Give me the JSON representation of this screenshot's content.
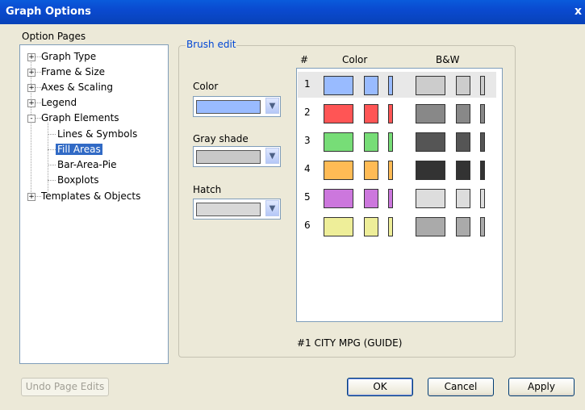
{
  "window": {
    "title": "Graph Options",
    "close": "x"
  },
  "option_pages": {
    "label": "Option Pages",
    "items": [
      {
        "label": "Graph Type",
        "expander": "+"
      },
      {
        "label": "Frame & Size",
        "expander": "+"
      },
      {
        "label": "Axes & Scaling",
        "expander": "+"
      },
      {
        "label": "Legend",
        "expander": "+"
      },
      {
        "label": "Graph Elements",
        "expander": "-"
      },
      {
        "label": "Lines & Symbols"
      },
      {
        "label": "Fill Areas",
        "selected": true
      },
      {
        "label": "Bar-Area-Pie"
      },
      {
        "label": "Boxplots"
      },
      {
        "label": "Templates & Objects",
        "expander": "+"
      }
    ]
  },
  "brush_edit": {
    "title": "Brush edit",
    "color_label": "Color",
    "color_value": "#99bbff",
    "gray_label": "Gray shade",
    "gray_value": "#c8c8c8",
    "hatch_label": "Hatch",
    "hatch_value": "#d8d8d8",
    "dropdown_icon": "chevron-down-icon"
  },
  "brush_table": {
    "headers": {
      "num": "#",
      "color": "Color",
      "bw": "B&W"
    },
    "rows": [
      {
        "num": "1",
        "color": "#99bbff",
        "gray": "#cccccc",
        "selected": true
      },
      {
        "num": "2",
        "color": "#ff5555",
        "gray": "#888888"
      },
      {
        "num": "3",
        "color": "#77dd77",
        "gray": "#555555"
      },
      {
        "num": "4",
        "color": "#ffbb55",
        "gray": "#333333"
      },
      {
        "num": "5",
        "color": "#cc77dd",
        "gray": "#dddddd"
      },
      {
        "num": "6",
        "color": "#eeee99",
        "gray": "#aaaaaa"
      }
    ]
  },
  "selection_caption": "#1  CITY MPG (GUIDE)",
  "buttons": {
    "undo": "Undo Page Edits",
    "ok": "OK",
    "cancel": "Cancel",
    "apply": "Apply"
  }
}
